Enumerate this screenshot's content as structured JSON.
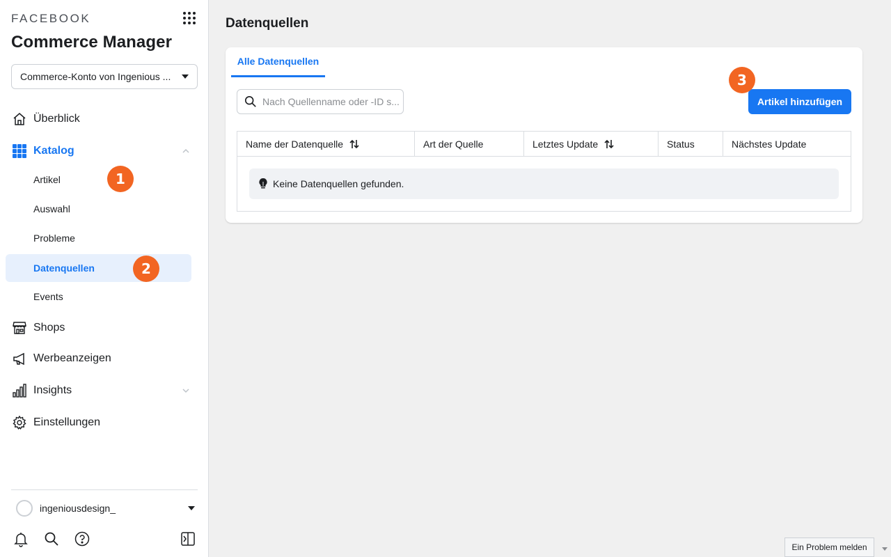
{
  "brand": "FACEBOOK",
  "app_title": "Commerce Manager",
  "account": {
    "selected": "Commerce-Konto von Ingenious ..."
  },
  "nav": {
    "overview": "Überblick",
    "catalog": "Katalog",
    "catalog_items": [
      "Artikel",
      "Auswahl",
      "Probleme",
      "Datenquellen",
      "Events"
    ],
    "shops": "Shops",
    "ads": "Werbeanzeigen",
    "insights": "Insights",
    "settings": "Einstellungen"
  },
  "badges": [
    "1",
    "2",
    "3"
  ],
  "profile": {
    "name": "ingeniousdesign_"
  },
  "main": {
    "title": "Datenquellen",
    "tab": "Alle Datenquellen",
    "search_placeholder": "Nach Quellenname oder -ID s...",
    "add_button": "Artikel hinzufügen",
    "columns": [
      "Name der Datenquelle",
      "Art der Quelle",
      "Letztes Update",
      "Status",
      "Nächstes Update"
    ],
    "empty_message": "Keine Datenquellen gefunden."
  },
  "report_button": "Ein Problem melden",
  "colors": {
    "accent": "#1877f2",
    "badge": "#f26522",
    "selected_bg": "#e7f0fd"
  }
}
